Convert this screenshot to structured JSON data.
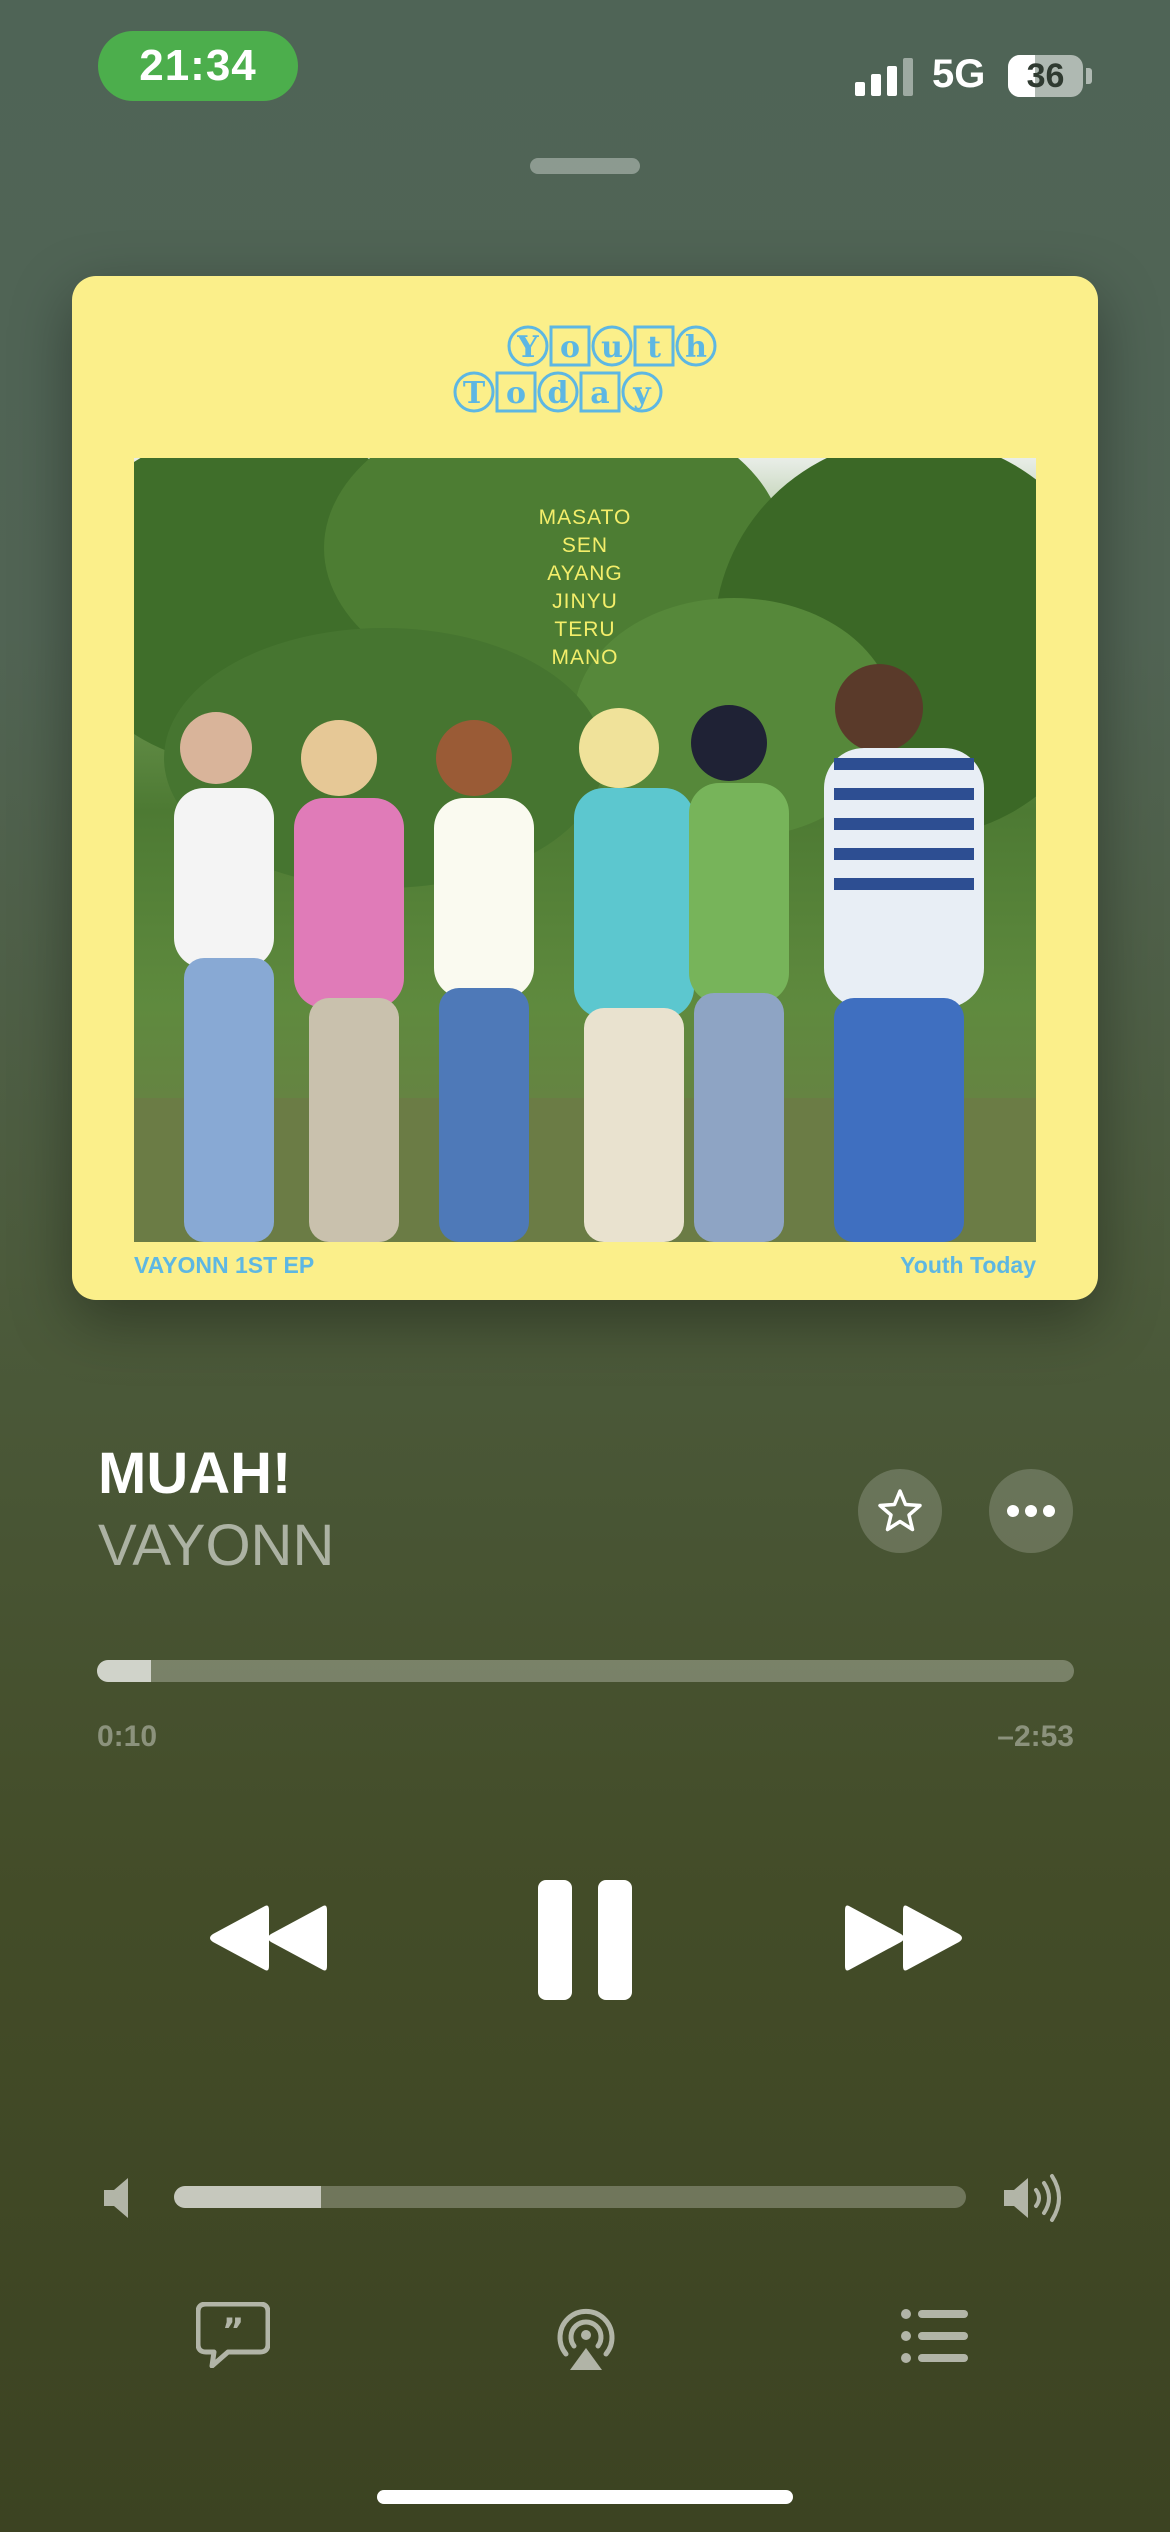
{
  "status_bar": {
    "time": "21:34",
    "network": "5G",
    "battery": "36",
    "battery_fraction": 0.36,
    "signal_icon": "cellular-signal-icon",
    "pill_color": "#4cae4c"
  },
  "album_art": {
    "logo_row1": [
      "Y",
      "o",
      "u",
      "t",
      "h"
    ],
    "logo_row2": [
      "T",
      "o",
      "d",
      "a",
      "y"
    ],
    "member_names": [
      "MASATO",
      "SEN",
      "AYANG",
      "JINYU",
      "TERU",
      "MANO"
    ],
    "footer_left": "VAYONN 1ST EP",
    "footer_right": "Youth Today",
    "background_color": "#fbef8a",
    "accent_color": "#5db7e3"
  },
  "now_playing": {
    "title": "MUAH!",
    "artist": "VAYONN",
    "favorite_icon": "star-icon",
    "more_icon": "ellipsis-icon"
  },
  "progress": {
    "elapsed": "0:10",
    "remaining": "–2:53",
    "fraction": 0.055
  },
  "controls": {
    "previous_icon": "rewind-icon",
    "play_pause_icon": "pause-icon",
    "next_icon": "fast-forward-icon"
  },
  "volume": {
    "level_fraction": 0.185,
    "low_icon": "speaker-low-icon",
    "high_icon": "speaker-high-icon"
  },
  "bottom_bar": {
    "lyrics_icon": "lyrics-quote-bubble-icon",
    "airplay_icon": "airplay-icon",
    "queue_icon": "queue-list-icon"
  }
}
